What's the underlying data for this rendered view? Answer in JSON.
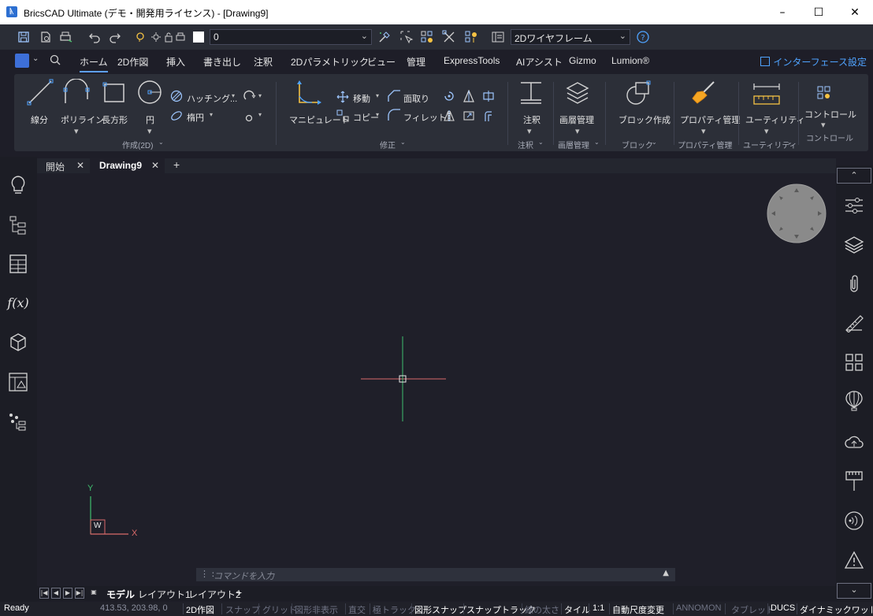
{
  "window": {
    "title": "BricsCAD Ultimate (デモ・開発用ライセンス) - [Drawing9]",
    "minimize": "–",
    "maximize": "☐",
    "close": "✕"
  },
  "qat": {
    "layer_value": "0",
    "workspace_value": "2Dワイヤフレーム"
  },
  "ribbon_tabs": [
    "ホーム",
    "2D作図",
    "挿入",
    "書き出し",
    "注釈",
    "2Dパラメトリック",
    "ビュー",
    "管理",
    "ExpressTools",
    "AIアシスト",
    "Gizmo",
    "Lumion®"
  ],
  "interface_settings": "インターフェース設定",
  "ribbon": {
    "line": "線分",
    "polyline": "ポリライン",
    "rectangle": "長方形",
    "circle": "円",
    "hatch": "ハッチング...",
    "ellipse": "楕円",
    "manipulate": "マニピュレート",
    "move": "移動",
    "copy": "コピー",
    "chamfer": "面取り",
    "fillet": "フィレット",
    "annotate": "注釈",
    "layer_manager": "画層管理",
    "make_block": "ブロック作成",
    "property_manager": "プロパティ管理",
    "utility": "ユーティリティ",
    "control": "コントロール",
    "group_create": "作成(2D)",
    "group_modify": "修正",
    "group_annotate": "注釈",
    "group_layer": "画層管理",
    "group_block": "ブロック",
    "group_property": "プロパティ管理",
    "group_utility": "ユーティリティ",
    "group_control": "コントロール"
  },
  "doc_tabs": [
    "開始",
    "Drawing9"
  ],
  "ucs": {
    "y": "Y",
    "x": "X",
    "w": "W"
  },
  "command": {
    "placeholder": "コマンドを入力"
  },
  "layout_tabs": [
    "モデル",
    "レイアウト1",
    "レイアウト2"
  ],
  "status": {
    "ready": "Ready",
    "coords": "413.53, 203.98, 0",
    "items": [
      "2D作図",
      "スナップ",
      "グリッド",
      "図形非表示",
      "直交",
      "極トラック",
      "図形スナップ",
      "スナップトラック",
      "線の太さ",
      "タイル",
      "1:1",
      "自動尺度変更",
      "ANNOMON",
      "タブレット",
      "DUCS",
      "ダイナミックワッドル"
    ]
  },
  "colors": {
    "accent": "#4fa3ff",
    "canvas": "#1f1f29",
    "crosshair_x": "#e06a6a",
    "crosshair_y": "#3fbf6f"
  }
}
